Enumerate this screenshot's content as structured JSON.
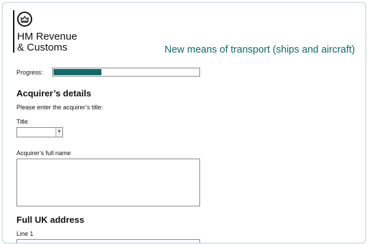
{
  "header": {
    "department_line1": "HM Revenue",
    "department_line2": "& Customs",
    "form_title": "New means of transport (ships and aircraft)",
    "crest_icon": "crown-crest-icon"
  },
  "progress": {
    "label": "Progress:",
    "fraction": 0.33,
    "fill_color": "#0f6b6b"
  },
  "acquirer": {
    "heading": "Acquirer’s details",
    "instruction": "Please enter the acquirer’s title:",
    "title_label": "Title",
    "title_value": "",
    "full_name_label": "Acquirer’s full name",
    "full_name_value": ""
  },
  "address": {
    "heading": "Full UK address",
    "line1_label": "Line 1",
    "line1_value": ""
  },
  "colors": {
    "accent": "#0b6b6b",
    "border": "#8a8a8a"
  }
}
